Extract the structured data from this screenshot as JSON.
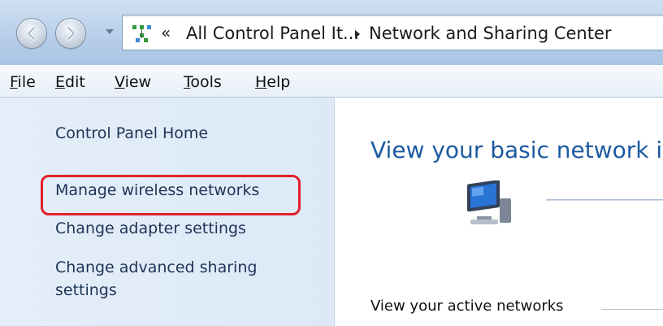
{
  "address_bar": {
    "overflow_chevron": "«",
    "crumbs": [
      "All Control Panel It...",
      "Network and Sharing Center"
    ]
  },
  "menu": {
    "items": [
      "File",
      "Edit",
      "View",
      "Tools",
      "Help"
    ]
  },
  "tasks": {
    "home": "Control Panel Home",
    "wireless": "Manage wireless networks",
    "adapter": "Change adapter settings",
    "sharing": "Change advanced sharing settings"
  },
  "main": {
    "title": "View your basic network i",
    "active_networks_label": "View your active networks"
  },
  "colors": {
    "highlight": "#e02028",
    "title_blue": "#1d5aa0",
    "link_navy": "#1e3456"
  },
  "icons": {
    "back": "back-arrow-icon",
    "forward": "forward-arrow-icon",
    "address": "network-control-panel-icon",
    "computer": "computer-icon"
  }
}
